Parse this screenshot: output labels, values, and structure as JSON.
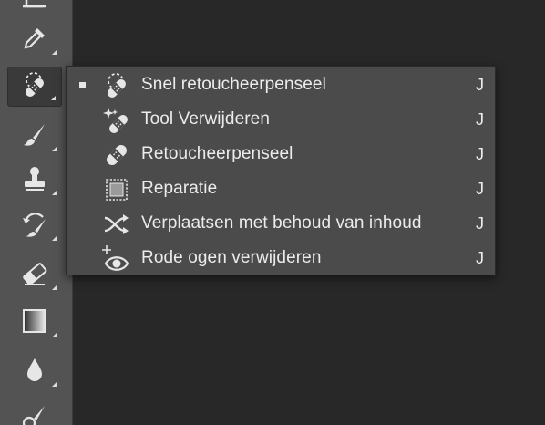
{
  "colors": {
    "toolbar_bg": "#535353",
    "workspace_bg": "#282828",
    "menu_bg": "#4b4b4b",
    "text": "#ececec",
    "icon": "#e6e6e6"
  },
  "toolbar": {
    "tools": [
      {
        "icon": "crop-frame-icon"
      },
      {
        "icon": "eyedropper-icon"
      },
      {
        "icon": "spot-healing-brush-icon",
        "active": true
      },
      {
        "icon": "brush-icon"
      },
      {
        "icon": "clone-stamp-icon"
      },
      {
        "icon": "history-brush-icon"
      },
      {
        "icon": "eraser-icon"
      },
      {
        "icon": "gradient-icon"
      },
      {
        "icon": "blur-drop-icon"
      },
      {
        "icon": "dodge-icon"
      }
    ]
  },
  "flyout": {
    "items": [
      {
        "label": "Snel retoucheerpenseel",
        "shortcut": "J",
        "selected": true,
        "icon": "spot-healing-brush-icon"
      },
      {
        "label": "Tool Verwijderen",
        "shortcut": "J",
        "selected": false,
        "icon": "remove-tool-icon"
      },
      {
        "label": "Retoucheerpenseel",
        "shortcut": "J",
        "selected": false,
        "icon": "healing-brush-icon"
      },
      {
        "label": "Reparatie",
        "shortcut": "J",
        "selected": false,
        "icon": "patch-tool-icon"
      },
      {
        "label": "Verplaatsen met behoud van inhoud",
        "shortcut": "J",
        "selected": false,
        "icon": "content-aware-move-icon"
      },
      {
        "label": "Rode ogen verwijderen",
        "shortcut": "J",
        "selected": false,
        "icon": "red-eye-icon"
      }
    ]
  }
}
